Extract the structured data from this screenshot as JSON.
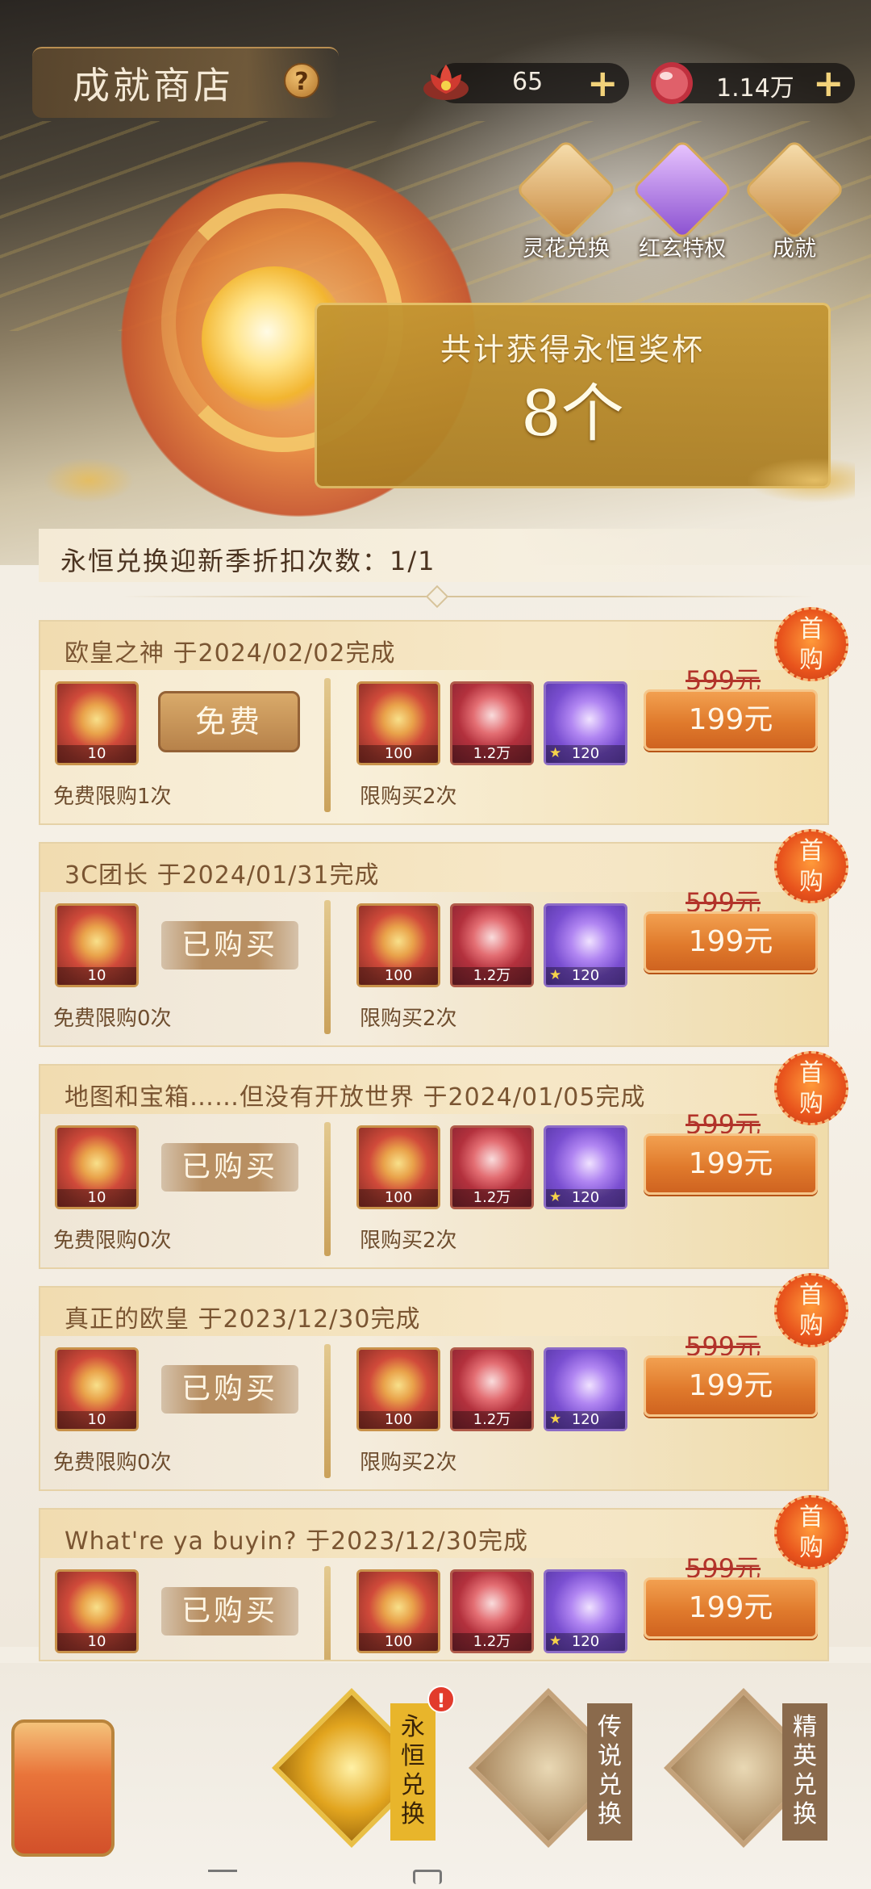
{
  "header": {
    "title": "成就商店",
    "help_label": "?",
    "currency_lotus": "65",
    "currency_pearl": "1.14万",
    "plus_label": "+"
  },
  "nav_icons": [
    {
      "label": "灵花兑换",
      "icon": "pavilion-icon"
    },
    {
      "label": "红玄特权",
      "icon": "checkmark-icon"
    },
    {
      "label": "成就",
      "icon": "lotus-icon"
    }
  ],
  "hero": {
    "trophy_title": "共计获得永恒奖杯",
    "trophy_count": "8个"
  },
  "discount": {
    "text": "永恒兑换迎新季折扣次数：1/1"
  },
  "cards": [
    {
      "title": "欧皇之神  于2024/02/02完成",
      "free_item_qty": "10",
      "free_button": "免费",
      "free_limit": "免费限购1次",
      "items": [
        {
          "qty": "100"
        },
        {
          "qty": "1.2万"
        },
        {
          "qty": "120"
        }
      ],
      "buy_limit": "限购买2次",
      "old_price": "599元",
      "price": "199元",
      "badge": "首购"
    },
    {
      "title": "3C团长  于2024/01/31完成",
      "free_item_qty": "10",
      "free_button": "已购买",
      "free_limit": "免费限购0次",
      "items": [
        {
          "qty": "100"
        },
        {
          "qty": "1.2万"
        },
        {
          "qty": "120"
        }
      ],
      "buy_limit": "限购买2次",
      "old_price": "599元",
      "price": "199元",
      "badge": "首购"
    },
    {
      "title": "地图和宝箱……但没有开放世界  于2024/01/05完成",
      "free_item_qty": "10",
      "free_button": "已购买",
      "free_limit": "免费限购0次",
      "items": [
        {
          "qty": "100"
        },
        {
          "qty": "1.2万"
        },
        {
          "qty": "120"
        }
      ],
      "buy_limit": "限购买2次",
      "old_price": "599元",
      "price": "199元",
      "badge": "首购"
    },
    {
      "title": "真正的欧皇  于2023/12/30完成",
      "free_item_qty": "10",
      "free_button": "已购买",
      "free_limit": "免费限购0次",
      "items": [
        {
          "qty": "100"
        },
        {
          "qty": "1.2万"
        },
        {
          "qty": "120"
        }
      ],
      "buy_limit": "限购买2次",
      "old_price": "599元",
      "price": "199元",
      "badge": "首购"
    },
    {
      "title": "What're ya buyin?   于2023/12/30完成",
      "free_item_qty": "10",
      "free_button": "已购买",
      "free_limit": "",
      "items": [
        {
          "qty": "100"
        },
        {
          "qty": "1.2万"
        },
        {
          "qty": "120"
        }
      ],
      "buy_limit": "",
      "old_price": "599元",
      "price": "199元",
      "badge": "首购"
    }
  ],
  "bottom_tabs": [
    {
      "label": "永恒兑换",
      "active": true
    },
    {
      "label": "传说兑换",
      "active": false
    },
    {
      "label": "精英兑换",
      "active": false
    }
  ],
  "alert_badge": "!",
  "colors": {
    "accent_gold": "#e8b52b",
    "price_orange": "#e07a2c",
    "strike_red": "#b2332a"
  }
}
